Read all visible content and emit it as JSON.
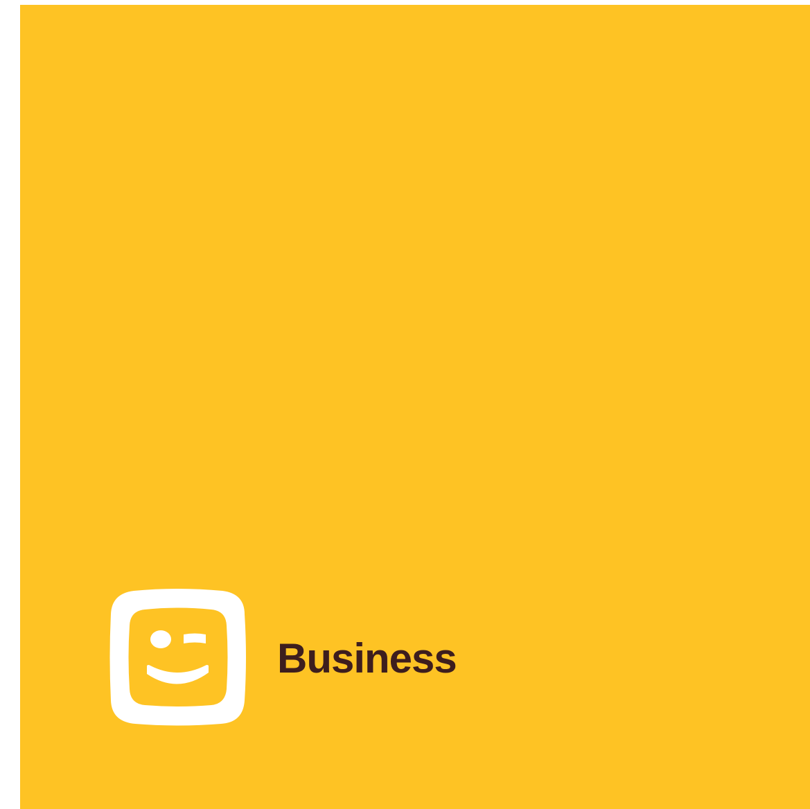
{
  "brand": {
    "label": "Business",
    "logo_icon": "winking-face-logo-icon"
  },
  "colors": {
    "background": "#FEC324",
    "logo": "#FFFFFF",
    "text": "#3D1E1E",
    "page": "#FFFFFF"
  }
}
